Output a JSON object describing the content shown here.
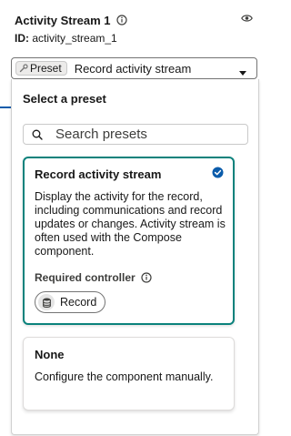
{
  "header": {
    "title": "Activity Stream 1",
    "id_label": "ID:",
    "id_value": "activity_stream_1"
  },
  "combobox": {
    "pill_label": "Preset",
    "value": "Record activity stream"
  },
  "dropdown": {
    "heading": "Select a preset",
    "search_placeholder": "Search presets",
    "options": [
      {
        "title": "Record activity stream",
        "description": "Display the activity for the record, including communications and record updates or changes. Activity stream is often used with the Compose component.",
        "required_label": "Required controller",
        "controller_pill": "Record",
        "selected": true
      },
      {
        "title": "None",
        "description": "Configure the component manually.",
        "selected": false
      }
    ]
  },
  "icons": [
    "info-icon",
    "eye-icon",
    "wrench-icon",
    "chevron-down-icon",
    "search-icon",
    "check-circle-icon",
    "database-icon"
  ],
  "colors": {
    "selected_border": "#0b827c",
    "check": "#0b5cab",
    "accent_line": "#0b5cab"
  }
}
